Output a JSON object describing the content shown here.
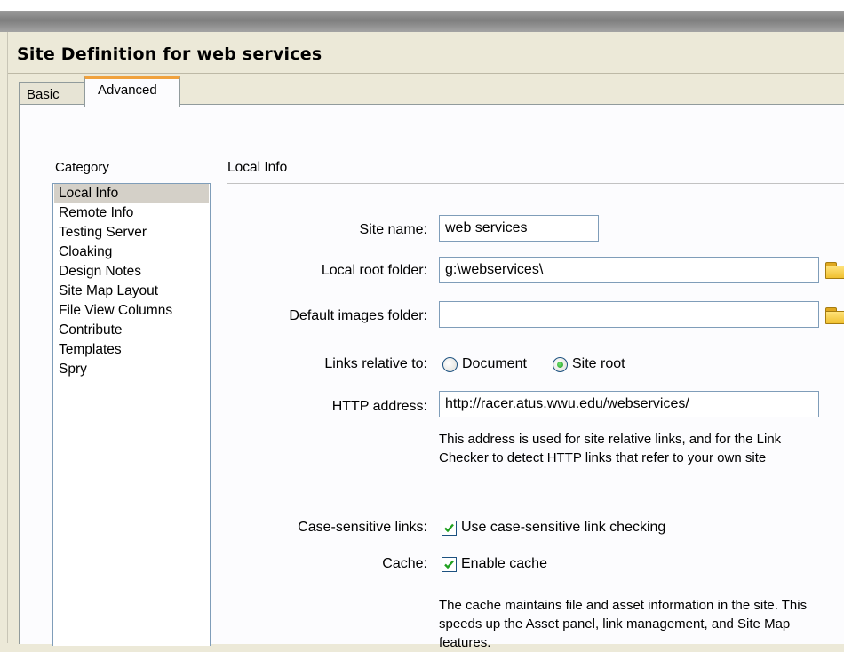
{
  "dialog": {
    "title": "Site Definition for web services",
    "tabs": [
      "Basic",
      "Advanced"
    ]
  },
  "category": {
    "heading": "Category",
    "items": [
      "Local Info",
      "Remote Info",
      "Testing Server",
      "Cloaking",
      "Design Notes",
      "Site Map Layout",
      "File View Columns",
      "Contribute",
      "Templates",
      "Spry"
    ],
    "selected": "Local Info"
  },
  "local_info": {
    "section_title": "Local Info",
    "site_name_label": "Site name:",
    "site_name_value": "web services",
    "local_root_label": "Local root folder:",
    "local_root_value": "g:\\webservices\\",
    "images_folder_label": "Default images folder:",
    "images_folder_value": "",
    "links_relative_label": "Links relative to:",
    "links_relative_options": [
      "Document",
      "Site root"
    ],
    "links_relative_selected": "Site root",
    "http_label": "HTTP address:",
    "http_value": "http://racer.atus.wwu.edu/webservices/",
    "http_note": "This address is used for site relative links, and for the Link Checker to detect HTTP links that refer to your own site",
    "case_label": "Case-sensitive links:",
    "case_checkbox": "Use case-sensitive link checking",
    "case_checked": true,
    "cache_label": "Cache:",
    "cache_checkbox": "Enable cache",
    "cache_checked": true,
    "cache_note": "The cache maintains file and asset information in the site.  This speeds up the Asset panel, link management, and Site Map features."
  },
  "icons": [
    "folder-icon",
    "checkmark-icon"
  ],
  "colors": {
    "tab_accent": "#f0a23e",
    "selected_item": "#d4d0c8",
    "check_green": "#21a121"
  }
}
